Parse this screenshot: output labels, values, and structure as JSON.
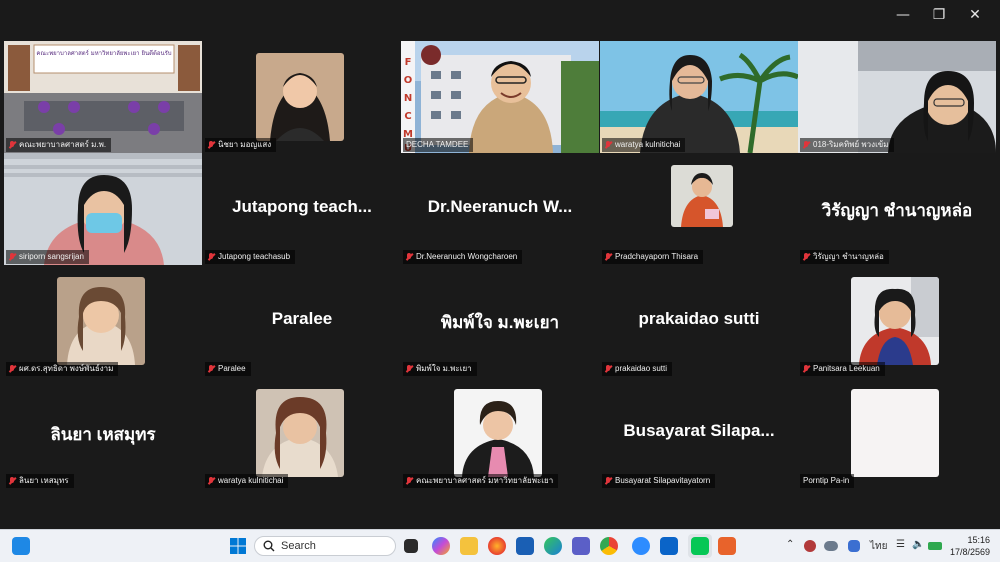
{
  "window": {
    "minimize_icon": "minimize-icon",
    "restore_icon": "restore-icon",
    "close_icon": "close-icon"
  },
  "participants": [
    {
      "name": "คณะพยาบาลศาสตร์ ม.พ.",
      "display": "",
      "type": "video-room",
      "banner": "คณะพยาบาลศาสตร์ มหาวิทยาลัยพะเยา ยินดีต้อนรับ"
    },
    {
      "name": "นิชยา มอญแสง",
      "display": "",
      "type": "video"
    },
    {
      "name": "DECHA TAMDEE",
      "display": "",
      "type": "video-active",
      "banner": "FONCMU",
      "building_sign": "สำนักงานคณะพยาบาลศาสตร์ มช"
    },
    {
      "name": "waratya kulnitichai",
      "display": "",
      "type": "video-beach"
    },
    {
      "name": "018-ริมคทิพย์ พวงเข้ม",
      "display": "",
      "type": "video"
    },
    {
      "name": "siriporn sangsrijan",
      "display": "",
      "type": "video-mask"
    },
    {
      "name": "Jutapong teachasub",
      "display": "Jutapong  teach...",
      "type": "name"
    },
    {
      "name": "Dr.Neeranuch Wongcharoen",
      "display": "Dr.Neeranuch  W...",
      "type": "name"
    },
    {
      "name": "Pradchayaporn Thisara",
      "display": "",
      "type": "photo"
    },
    {
      "name": "วิรัญญา ชำนาญหล่อ",
      "display": "วิรัญญา  ชำนาญหล่อ",
      "type": "name"
    },
    {
      "name": "ผศ.ดร.สุทธิดา พงษ์พันธ์งาม",
      "display": "",
      "type": "photo"
    },
    {
      "name": "Paralee",
      "display": "Paralee",
      "type": "name"
    },
    {
      "name": "พิมพ์ใจ ม.พะเยา",
      "display": "พิมพ์ใจ  ม.พะเยา",
      "type": "name"
    },
    {
      "name": "prakaidao sutti",
      "display": "prakaidao  sutti",
      "type": "name"
    },
    {
      "name": "Panitsara Leekuan",
      "display": "",
      "type": "photo"
    },
    {
      "name": "ลินยา เหสมุทร",
      "display": "ลินยา  เหสมุทร",
      "type": "name"
    },
    {
      "name": "waratya kulnitichai",
      "display": "",
      "type": "photo"
    },
    {
      "name": "คณะพยาบาลศาสตร์ มหาวิทยาลัยพะเยา",
      "display": "",
      "type": "photo"
    },
    {
      "name": "Busayarat Silapavitayatorn",
      "display": "Busayarat  Silapa...",
      "type": "name"
    },
    {
      "name": "Porntip Pa-in",
      "display": "",
      "type": "photo-blank"
    }
  ],
  "taskbar": {
    "search_placeholder": "Search",
    "language": "ไทย",
    "time": "15:16",
    "date": "17/8/2569",
    "pinned_icons": [
      "start-icon",
      "search-icon",
      "task-view-icon",
      "copilot-icon",
      "file-explorer-icon",
      "firefox-icon",
      "store-icon",
      "edge-icon",
      "teams-icon",
      "chrome-icon",
      "zoom-icon",
      "outlook-icon",
      "line-icon",
      "reader-icon"
    ],
    "accent": "#0067c0"
  }
}
